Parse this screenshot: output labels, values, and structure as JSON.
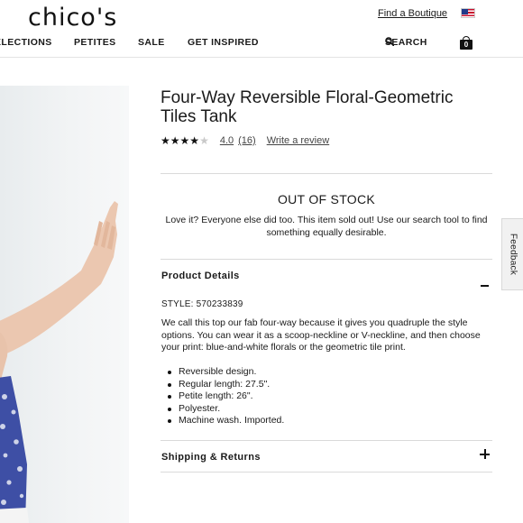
{
  "header": {
    "logo": "chico's",
    "find_boutique": "Find a Boutique",
    "flag_icon": "us-flag-icon",
    "bag_count": "0"
  },
  "nav": {
    "collections": "ELECTIONS",
    "petites": "PETITES",
    "sale": "SALE",
    "get_inspired": "GET INSPIRED",
    "search": "SEARCH"
  },
  "product": {
    "title": "Four-Way Reversible Floral-Geometric Tiles Tank",
    "rating": "4.0",
    "rating_count": "(16)",
    "rating_value": 4.0,
    "write_review": "Write a review",
    "out_of_stock": "OUT OF STOCK",
    "out_of_stock_message": "Love it? Everyone else did too. This item sold out! Use our search tool to find something equally desirable.",
    "details_heading": "Product Details",
    "style": "STYLE: 570233839",
    "description": "We call this top our fab four-way because it gives you quadruple the style options. You can wear it as a scoop-neckline or V-neckline, and then choose your print: blue-and-white florals or the geometric tile print.",
    "bullets": [
      "Reversible design.",
      "Regular length: 27.5\".",
      "Petite length: 26\".",
      "Polyester.",
      "Machine wash. Imported."
    ],
    "shipping_heading": "Shipping & Returns"
  },
  "feedback_tab": "Feedback",
  "colors": {
    "text": "#1a1a1a",
    "rule": "#dadada",
    "image_bg": "#eef1f2"
  }
}
